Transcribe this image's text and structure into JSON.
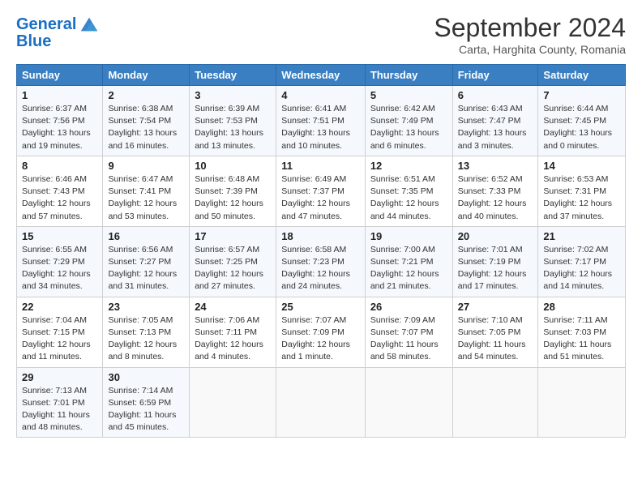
{
  "header": {
    "logo_line1": "General",
    "logo_line2": "Blue",
    "month": "September 2024",
    "location": "Carta, Harghita County, Romania"
  },
  "weekdays": [
    "Sunday",
    "Monday",
    "Tuesday",
    "Wednesday",
    "Thursday",
    "Friday",
    "Saturday"
  ],
  "weeks": [
    [
      {
        "day": "1",
        "sunrise": "Sunrise: 6:37 AM",
        "sunset": "Sunset: 7:56 PM",
        "daylight": "Daylight: 13 hours and 19 minutes."
      },
      {
        "day": "2",
        "sunrise": "Sunrise: 6:38 AM",
        "sunset": "Sunset: 7:54 PM",
        "daylight": "Daylight: 13 hours and 16 minutes."
      },
      {
        "day": "3",
        "sunrise": "Sunrise: 6:39 AM",
        "sunset": "Sunset: 7:53 PM",
        "daylight": "Daylight: 13 hours and 13 minutes."
      },
      {
        "day": "4",
        "sunrise": "Sunrise: 6:41 AM",
        "sunset": "Sunset: 7:51 PM",
        "daylight": "Daylight: 13 hours and 10 minutes."
      },
      {
        "day": "5",
        "sunrise": "Sunrise: 6:42 AM",
        "sunset": "Sunset: 7:49 PM",
        "daylight": "Daylight: 13 hours and 6 minutes."
      },
      {
        "day": "6",
        "sunrise": "Sunrise: 6:43 AM",
        "sunset": "Sunset: 7:47 PM",
        "daylight": "Daylight: 13 hours and 3 minutes."
      },
      {
        "day": "7",
        "sunrise": "Sunrise: 6:44 AM",
        "sunset": "Sunset: 7:45 PM",
        "daylight": "Daylight: 13 hours and 0 minutes."
      }
    ],
    [
      {
        "day": "8",
        "sunrise": "Sunrise: 6:46 AM",
        "sunset": "Sunset: 7:43 PM",
        "daylight": "Daylight: 12 hours and 57 minutes."
      },
      {
        "day": "9",
        "sunrise": "Sunrise: 6:47 AM",
        "sunset": "Sunset: 7:41 PM",
        "daylight": "Daylight: 12 hours and 53 minutes."
      },
      {
        "day": "10",
        "sunrise": "Sunrise: 6:48 AM",
        "sunset": "Sunset: 7:39 PM",
        "daylight": "Daylight: 12 hours and 50 minutes."
      },
      {
        "day": "11",
        "sunrise": "Sunrise: 6:49 AM",
        "sunset": "Sunset: 7:37 PM",
        "daylight": "Daylight: 12 hours and 47 minutes."
      },
      {
        "day": "12",
        "sunrise": "Sunrise: 6:51 AM",
        "sunset": "Sunset: 7:35 PM",
        "daylight": "Daylight: 12 hours and 44 minutes."
      },
      {
        "day": "13",
        "sunrise": "Sunrise: 6:52 AM",
        "sunset": "Sunset: 7:33 PM",
        "daylight": "Daylight: 12 hours and 40 minutes."
      },
      {
        "day": "14",
        "sunrise": "Sunrise: 6:53 AM",
        "sunset": "Sunset: 7:31 PM",
        "daylight": "Daylight: 12 hours and 37 minutes."
      }
    ],
    [
      {
        "day": "15",
        "sunrise": "Sunrise: 6:55 AM",
        "sunset": "Sunset: 7:29 PM",
        "daylight": "Daylight: 12 hours and 34 minutes."
      },
      {
        "day": "16",
        "sunrise": "Sunrise: 6:56 AM",
        "sunset": "Sunset: 7:27 PM",
        "daylight": "Daylight: 12 hours and 31 minutes."
      },
      {
        "day": "17",
        "sunrise": "Sunrise: 6:57 AM",
        "sunset": "Sunset: 7:25 PM",
        "daylight": "Daylight: 12 hours and 27 minutes."
      },
      {
        "day": "18",
        "sunrise": "Sunrise: 6:58 AM",
        "sunset": "Sunset: 7:23 PM",
        "daylight": "Daylight: 12 hours and 24 minutes."
      },
      {
        "day": "19",
        "sunrise": "Sunrise: 7:00 AM",
        "sunset": "Sunset: 7:21 PM",
        "daylight": "Daylight: 12 hours and 21 minutes."
      },
      {
        "day": "20",
        "sunrise": "Sunrise: 7:01 AM",
        "sunset": "Sunset: 7:19 PM",
        "daylight": "Daylight: 12 hours and 17 minutes."
      },
      {
        "day": "21",
        "sunrise": "Sunrise: 7:02 AM",
        "sunset": "Sunset: 7:17 PM",
        "daylight": "Daylight: 12 hours and 14 minutes."
      }
    ],
    [
      {
        "day": "22",
        "sunrise": "Sunrise: 7:04 AM",
        "sunset": "Sunset: 7:15 PM",
        "daylight": "Daylight: 12 hours and 11 minutes."
      },
      {
        "day": "23",
        "sunrise": "Sunrise: 7:05 AM",
        "sunset": "Sunset: 7:13 PM",
        "daylight": "Daylight: 12 hours and 8 minutes."
      },
      {
        "day": "24",
        "sunrise": "Sunrise: 7:06 AM",
        "sunset": "Sunset: 7:11 PM",
        "daylight": "Daylight: 12 hours and 4 minutes."
      },
      {
        "day": "25",
        "sunrise": "Sunrise: 7:07 AM",
        "sunset": "Sunset: 7:09 PM",
        "daylight": "Daylight: 12 hours and 1 minute."
      },
      {
        "day": "26",
        "sunrise": "Sunrise: 7:09 AM",
        "sunset": "Sunset: 7:07 PM",
        "daylight": "Daylight: 11 hours and 58 minutes."
      },
      {
        "day": "27",
        "sunrise": "Sunrise: 7:10 AM",
        "sunset": "Sunset: 7:05 PM",
        "daylight": "Daylight: 11 hours and 54 minutes."
      },
      {
        "day": "28",
        "sunrise": "Sunrise: 7:11 AM",
        "sunset": "Sunset: 7:03 PM",
        "daylight": "Daylight: 11 hours and 51 minutes."
      }
    ],
    [
      {
        "day": "29",
        "sunrise": "Sunrise: 7:13 AM",
        "sunset": "Sunset: 7:01 PM",
        "daylight": "Daylight: 11 hours and 48 minutes."
      },
      {
        "day": "30",
        "sunrise": "Sunrise: 7:14 AM",
        "sunset": "Sunset: 6:59 PM",
        "daylight": "Daylight: 11 hours and 45 minutes."
      },
      null,
      null,
      null,
      null,
      null
    ]
  ]
}
